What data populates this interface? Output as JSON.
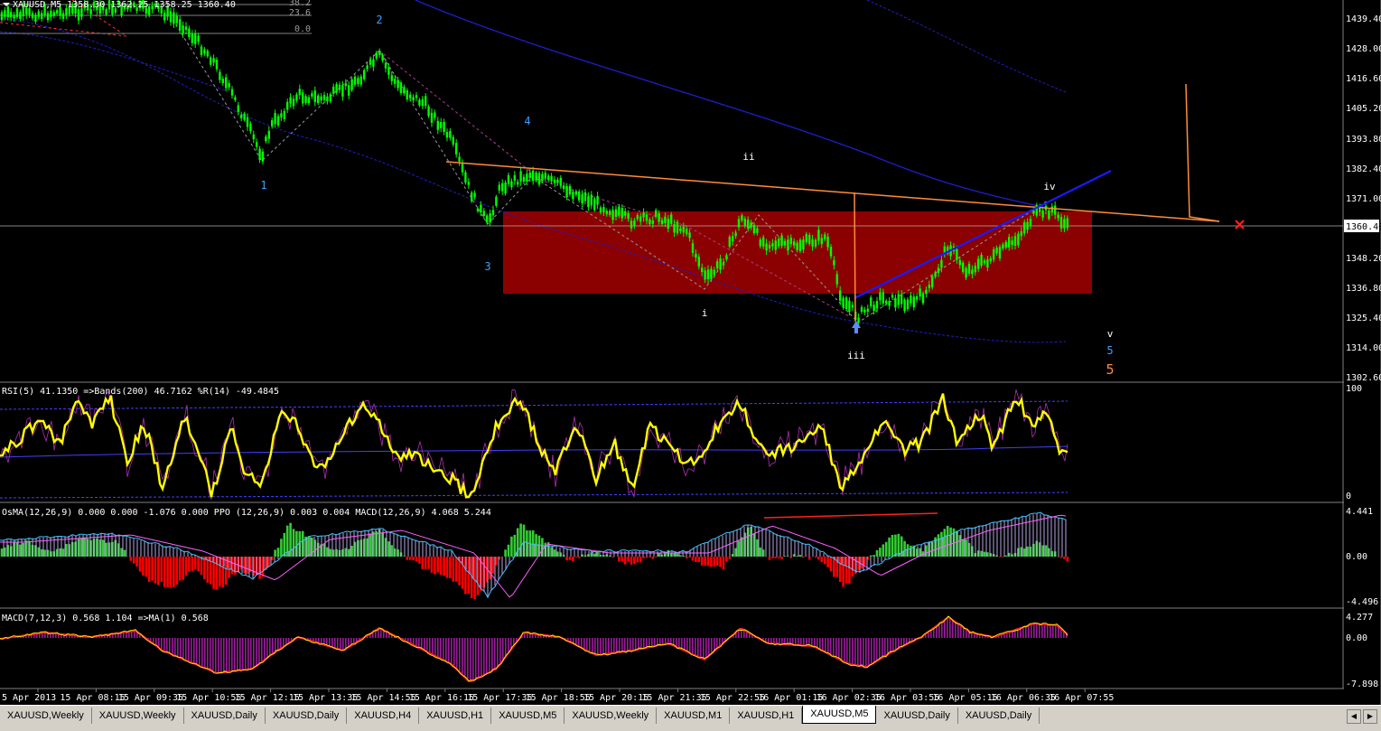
{
  "window": {
    "header": "XAUUSD,M5  1358.30 1362.25 1358.25 1360.40"
  },
  "fibo_levels": [
    "38.2",
    "23.6",
    "0.0"
  ],
  "price_axis": {
    "labels": [
      "1439.40",
      "1428.00",
      "1416.60",
      "1405.20",
      "1393.80",
      "1382.40",
      "1371.00",
      "1348.20",
      "1336.80",
      "1325.40",
      "1314.00",
      "1302.60"
    ],
    "current": "1360.40"
  },
  "wave_labels": {
    "w1": "1",
    "w2": "2",
    "w3": "3",
    "w4": "4",
    "w5": "5",
    "w5_big": "5",
    "wi": "i",
    "wii": "ii",
    "wiii": "iii",
    "wiv": "iv",
    "wv": "v"
  },
  "indicators": {
    "rsi": {
      "header": "RSI(5) 41.1350  =>Bands(200) 46.7162  %R(14) -49.4845",
      "axis": [
        "100",
        "0"
      ]
    },
    "osma": {
      "header": "OsMA(12,26,9) 0.000 0.000 -1.076 0.000  PPO (12,26,9) 0.003 0.004  MACD(12,26,9) 4.068 5.244",
      "axis": [
        "4.441",
        "0.00",
        "-4.496"
      ]
    },
    "macd2": {
      "header": "MACD(7,12,3) 0.568 1.104  =>MA(1) 0.568",
      "axis": [
        "4.277",
        "0.00",
        "-7.898"
      ]
    }
  },
  "time_axis": [
    "5 Apr 2013",
    "15 Apr 08:15",
    "15 Apr 09:35",
    "15 Apr 10:55",
    "15 Apr 12:15",
    "15 Apr 13:35",
    "15 Apr 14:55",
    "15 Apr 16:15",
    "15 Apr 17:35",
    "15 Apr 18:55",
    "15 Apr 20:15",
    "15 Apr 21:35",
    "15 Apr 22:55",
    "16 Apr 01:15",
    "16 Apr 02:35",
    "16 Apr 03:55",
    "16 Apr 05:15",
    "16 Apr 06:35",
    "16 Apr 07:55"
  ],
  "tabs": [
    "XAUUSD,Weekly",
    "XAUUSD,Weekly",
    "XAUUSD,Daily",
    "XAUUSD,Daily",
    "XAUUSD,H4",
    "XAUUSD,H1",
    "XAUUSD,M5",
    "XAUUSD,Weekly",
    "XAUUSD,M1",
    "XAUUSD,H1",
    "XAUUSD,M5",
    "XAUUSD,Daily",
    "XAUUSD,Daily"
  ],
  "active_tab": 10,
  "colors": {
    "candle": "#00ff00",
    "box": "#8b0000",
    "trend_orange": "#ff8c3a",
    "trend_blue": "#1a1aff",
    "rsi_line": "#ffff00",
    "osma_pos": "#33cc33",
    "osma_neg": "#ff0000",
    "macd_hist": "#9b1b9b",
    "wave_cyan": "#3aa0ff"
  }
}
